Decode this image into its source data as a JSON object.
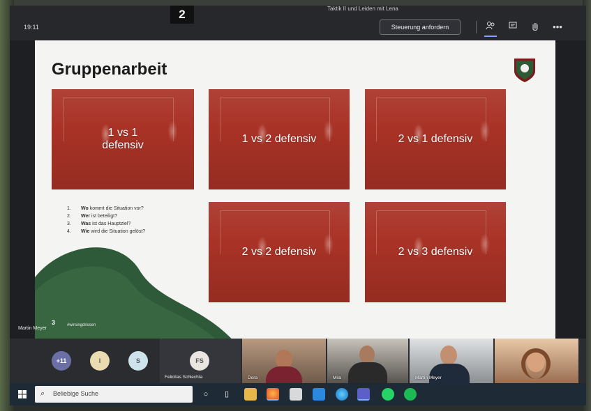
{
  "meeting": {
    "title": "Taktik II und Leiden mit Lena",
    "time": "19:11",
    "page_badge": "2",
    "request_control_label": "Steuerung anfordern"
  },
  "toolbar": {
    "icons": [
      "people-icon",
      "chat-icon",
      "raise-hand-icon",
      "more-icon"
    ],
    "more_glyph": "•••"
  },
  "slide": {
    "title": "Gruppenarbeit",
    "tiles": [
      {
        "label": "1 vs 1\ndefensiv"
      },
      {
        "label": "1 vs 2 defensiv"
      },
      {
        "label": "2 vs 1 defensiv"
      },
      {
        "label": "2 vs 2 defensiv"
      },
      {
        "label": "2 vs 3 defensiv"
      }
    ],
    "questions": [
      {
        "num": "1.",
        "bold": "Wo",
        "rest": " kommt die Situation vor?"
      },
      {
        "num": "2.",
        "bold": "Wer",
        "rest": " ist beteiligt?"
      },
      {
        "num": "3.",
        "bold": "Was",
        "rest": " ist das Hauptziel?"
      },
      {
        "num": "4.",
        "bold": "Wie",
        "rest": " wird die Situation gelöst?"
      }
    ],
    "hashtag": "#wirsingdrissen"
  },
  "participants": {
    "presenter_name": "Martin Meyer",
    "presenter_count": "3",
    "more_count": "+11",
    "avatar_i": "I",
    "avatar_s": "S",
    "avatar_fs": "FS",
    "fs_name": "Felicitas Schlechta",
    "videos": [
      {
        "name": "Dora"
      },
      {
        "name": "Mila"
      },
      {
        "name": "Martin Meyer"
      },
      {
        "name": ""
      }
    ]
  },
  "taskbar": {
    "search_placeholder": "Beliebige Suche",
    "icons": [
      "cortana-icon",
      "task-view-icon",
      "explorer-icon",
      "firefox-icon",
      "store-icon",
      "mail-icon",
      "edge-icon",
      "teams-icon",
      "whatsapp-icon",
      "spotify-icon"
    ]
  },
  "colors": {
    "tile_red": "#a93226",
    "slide_bg": "#f4f4f2",
    "green_wave": "#2f5a3a",
    "topbar": "#26282c",
    "taskbar": "#1e2a35"
  }
}
